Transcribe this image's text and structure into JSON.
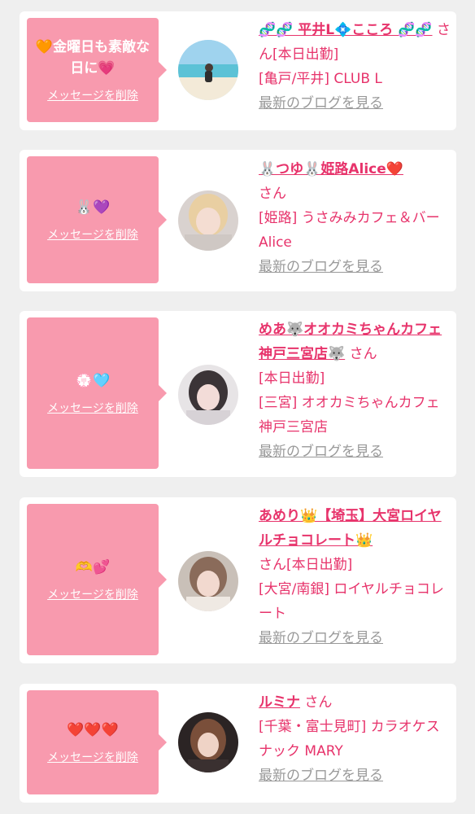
{
  "cards": [
    {
      "message": "🧡金曜日も素敵な日に💗",
      "delete_label": "メッセージを削除",
      "name": "🧬🧬 平井L💠こころ 🧬🧬",
      "san": "さん",
      "status": "[本日出勤]",
      "shop": "[亀戸/平井] CLUB L",
      "blog": "最新のブログを見る"
    },
    {
      "message": "🐰💜",
      "delete_label": "メッセージを削除",
      "name": "🐰つゆ🐰姫路Alice❤️",
      "san": "さん",
      "status": "",
      "shop": "[姫路] うさみみカフェ＆バー　Alice",
      "blog": "最新のブログを見る"
    },
    {
      "message": "💮🩵",
      "delete_label": "メッセージを削除",
      "name": "めあ🐺オオカミちゃんカフェ神戸三宮店🐺",
      "san": "さん",
      "status": "[本日出勤]",
      "shop": "[三宮] オオカミちゃんカフェ神戸三宮店",
      "blog": "最新のブログを見る"
    },
    {
      "message": "🫶💕",
      "delete_label": "メッセージを削除",
      "name": "あめり👑【埼玉】大宮ロイヤルチョコレート👑",
      "san": "さん",
      "status": "[本日出勤]",
      "shop": "[大宮/南銀] ロイヤルチョコレート",
      "blog": "最新のブログを見る"
    },
    {
      "message": "❤️❤️❤️",
      "delete_label": "メッセージを削除",
      "name": "ルミナ",
      "san": "さん",
      "status": "",
      "shop": "[千葉・富士見町] カラオケスナック MARY",
      "blog": "最新のブログを見る"
    }
  ],
  "colors": {
    "background": "#efefef",
    "bubble": "#f89aae",
    "accent": "#e7336b",
    "link_gray": "#999999"
  }
}
